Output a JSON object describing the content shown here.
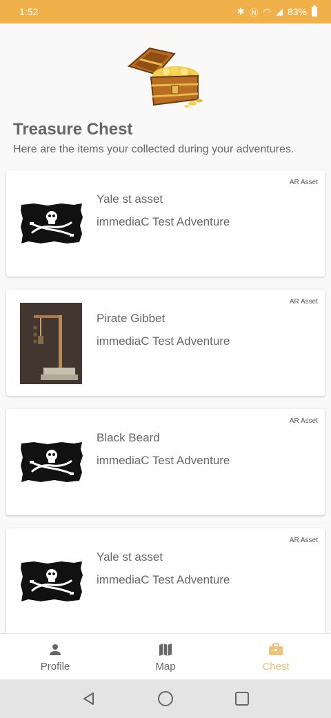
{
  "status_bar": {
    "time": "1:52",
    "battery": "83%"
  },
  "header": {
    "title": "Treasure Chest",
    "subtitle": "Here are the items your collected during your adventures."
  },
  "items": [
    {
      "badge": "AR Asset",
      "name": "Yale st asset",
      "adventure": "immediaC Test Adventure",
      "thumbnail": "pirate-flag"
    },
    {
      "badge": "AR Asset",
      "name": "Pirate Gibbet",
      "adventure": "immediaC Test Adventure",
      "thumbnail": "gibbet-photo"
    },
    {
      "badge": "AR Asset",
      "name": "Black Beard",
      "adventure": "immediaC Test Adventure",
      "thumbnail": "pirate-flag"
    },
    {
      "badge": "AR Asset",
      "name": "Yale st asset",
      "adventure": "immediaC Test Adventure",
      "thumbnail": "pirate-flag"
    }
  ],
  "bottom_nav": [
    {
      "label": "Profile",
      "icon": "person-icon",
      "active": false
    },
    {
      "label": "Map",
      "icon": "map-icon",
      "active": false
    },
    {
      "label": "Chest",
      "icon": "briefcase-icon",
      "active": true
    }
  ],
  "colors": {
    "status_bar": "#f0b14a",
    "active_tab": "#f0c27a",
    "text": "#666666"
  }
}
